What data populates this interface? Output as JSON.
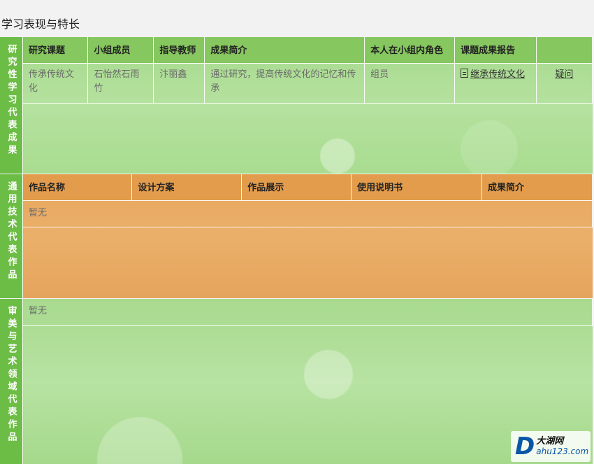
{
  "page_title": "学习表现与特长",
  "research": {
    "side_label": "研究性学习代表成果",
    "headers": [
      "研究课题",
      "小组成员",
      "指导教师",
      "成果简介",
      "本人在小组内角色",
      "课题成果报告",
      ""
    ],
    "row": {
      "topic": "传承传统文化",
      "members": "石怡然石雨竹",
      "teacher": "汴丽鑫",
      "summary": "通过研究，提高传统文化的记忆和传承",
      "role": "组员",
      "report_link": "继承传统文化",
      "question_link": "疑问"
    }
  },
  "tech": {
    "side_label": "通用技术代表作品",
    "headers": [
      "作品名称",
      "设计方案",
      "作品展示",
      "使用说明书",
      "成果简介"
    ],
    "empty_text": "暂无"
  },
  "art": {
    "side_label": "审美与艺术领域代表作品",
    "empty_text": "暂无"
  },
  "watermark": {
    "letter": "D",
    "cn": "大湖网",
    "url": "ahu123.com"
  }
}
